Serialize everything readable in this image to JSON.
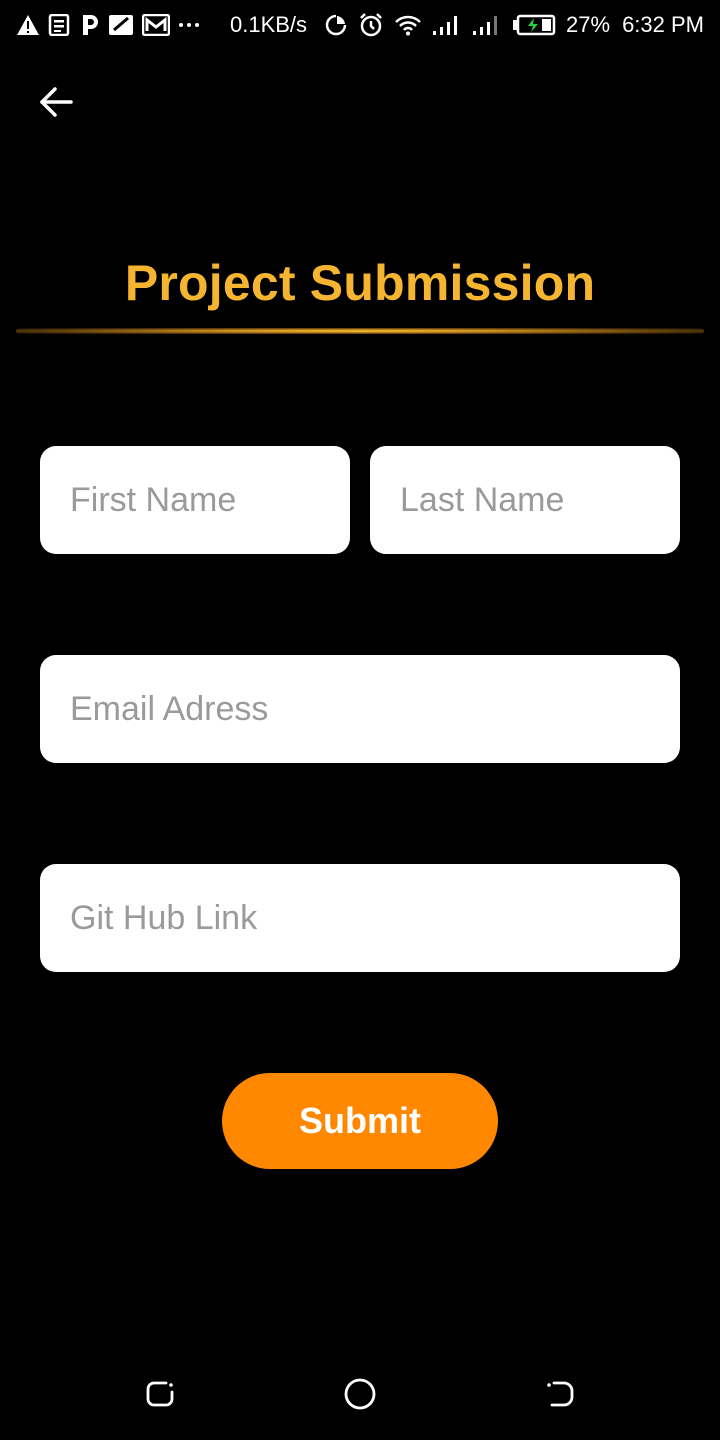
{
  "status_bar": {
    "net_speed": "0.1KB/s",
    "battery": "27%",
    "time": "6:32 PM",
    "notif_icons": [
      "warning-icon",
      "news-icon",
      "paytm-icon",
      "sim-icon",
      "gmail-icon",
      "more-dots-icon"
    ],
    "system_icons": [
      "data-saver-icon",
      "alarm-icon",
      "wifi-icon",
      "signal-icon",
      "signal-2-icon",
      "battery-charging-icon"
    ]
  },
  "header": {
    "title": "Project Submission",
    "back_icon": "arrow-left-icon"
  },
  "form": {
    "first_name": {
      "placeholder": "First Name",
      "value": ""
    },
    "last_name": {
      "placeholder": "Last Name",
      "value": ""
    },
    "email": {
      "placeholder": "Email Adress",
      "value": ""
    },
    "github": {
      "placeholder": "Git Hub Link",
      "value": ""
    },
    "submit_label": "Submit"
  },
  "nav_bar": {
    "icons": [
      "recent-apps-icon",
      "home-icon",
      "back-nav-icon"
    ]
  },
  "colors": {
    "background": "#000000",
    "title": "#f5b531",
    "accent": "#ff8800",
    "field_bg": "#ffffff",
    "placeholder": "#9a9a9a"
  }
}
